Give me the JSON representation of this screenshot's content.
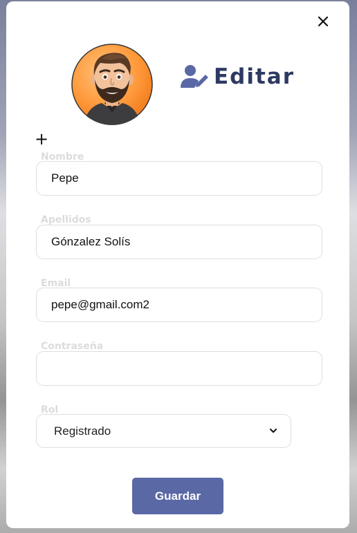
{
  "modal": {
    "title": "Editar",
    "close_icon": "close-icon",
    "title_icon": "user-edit-icon",
    "add_icon_symbol": "+",
    "accent_color": "#5a68a5",
    "title_color": "#2e3a63"
  },
  "form": {
    "nombre": {
      "label": "Nombre",
      "value": "Pepe"
    },
    "apellidos": {
      "label": "Apellidos",
      "value": "Gónzalez Solís"
    },
    "email": {
      "label": "Email",
      "value": "pepe@gmail.com2"
    },
    "contrasena": {
      "label": "Contraseña",
      "value": ""
    },
    "rol": {
      "label": "Rol",
      "selected": "Registrado"
    }
  },
  "actions": {
    "save_label": "Guardar"
  }
}
